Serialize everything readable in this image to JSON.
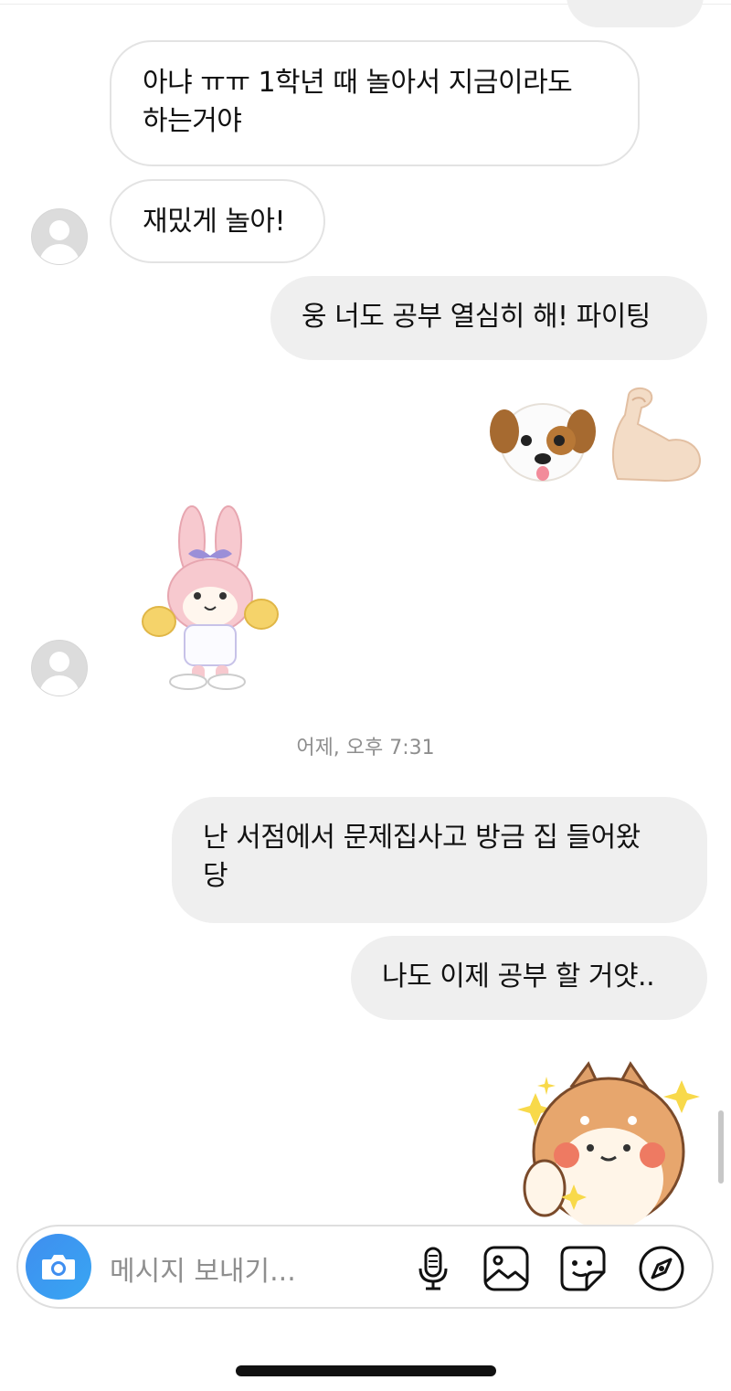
{
  "messages": {
    "m1": "아냐 ㅠㅠ 1학년 때 놀아서 지금이라도\n하는거야",
    "m2": "재밌게 놀아!",
    "m3": "웅 너도 공부 열심히 해! 파이팅",
    "m5": "난 서점에서 문제집사고 방금 집 들어왔\n당",
    "m6": "나도 이제 공부 할 거얏.."
  },
  "timestamp": "어제, 오후 7:31",
  "composer": {
    "placeholder": "메시지 보내기...",
    "icons": [
      "camera-icon",
      "microphone-icon",
      "gallery-icon",
      "sticker-icon",
      "explore-icon"
    ]
  },
  "stickers": [
    "dog-animoji",
    "flexed-biceps",
    "pink-bunny-cheer-sticker",
    "shiba-dog-sparkle-sticker"
  ],
  "colors": {
    "accent": "#3f8ef0",
    "sent_bubble": "#efefef",
    "received_border": "#e3e3e3",
    "timestamp": "#8e8e8e"
  }
}
